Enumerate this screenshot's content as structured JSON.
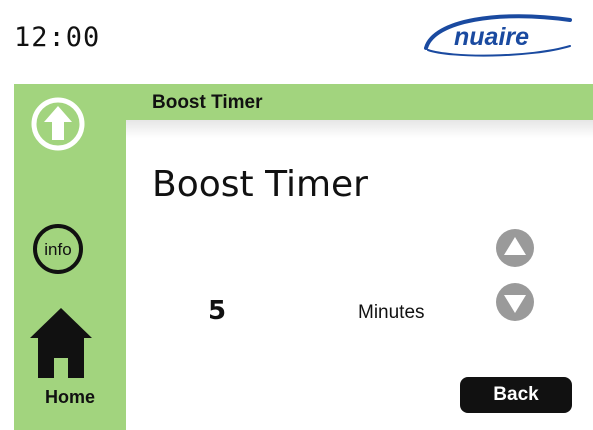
{
  "status": {
    "time": "12:00"
  },
  "brand": {
    "name": "nuaire",
    "color": "#1a4aa0"
  },
  "sidebar": {
    "boost_icon": "up-arrow-circle-icon",
    "info_label": "info",
    "home_label": "Home",
    "accent_color": "#a2d47e"
  },
  "header": {
    "title": "Boost Timer"
  },
  "main": {
    "title": "Boost Timer",
    "value": "5",
    "unit": "Minutes",
    "increase_icon": "triangle-up-icon",
    "decrease_icon": "triangle-down-icon"
  },
  "footer": {
    "back_label": "Back"
  }
}
